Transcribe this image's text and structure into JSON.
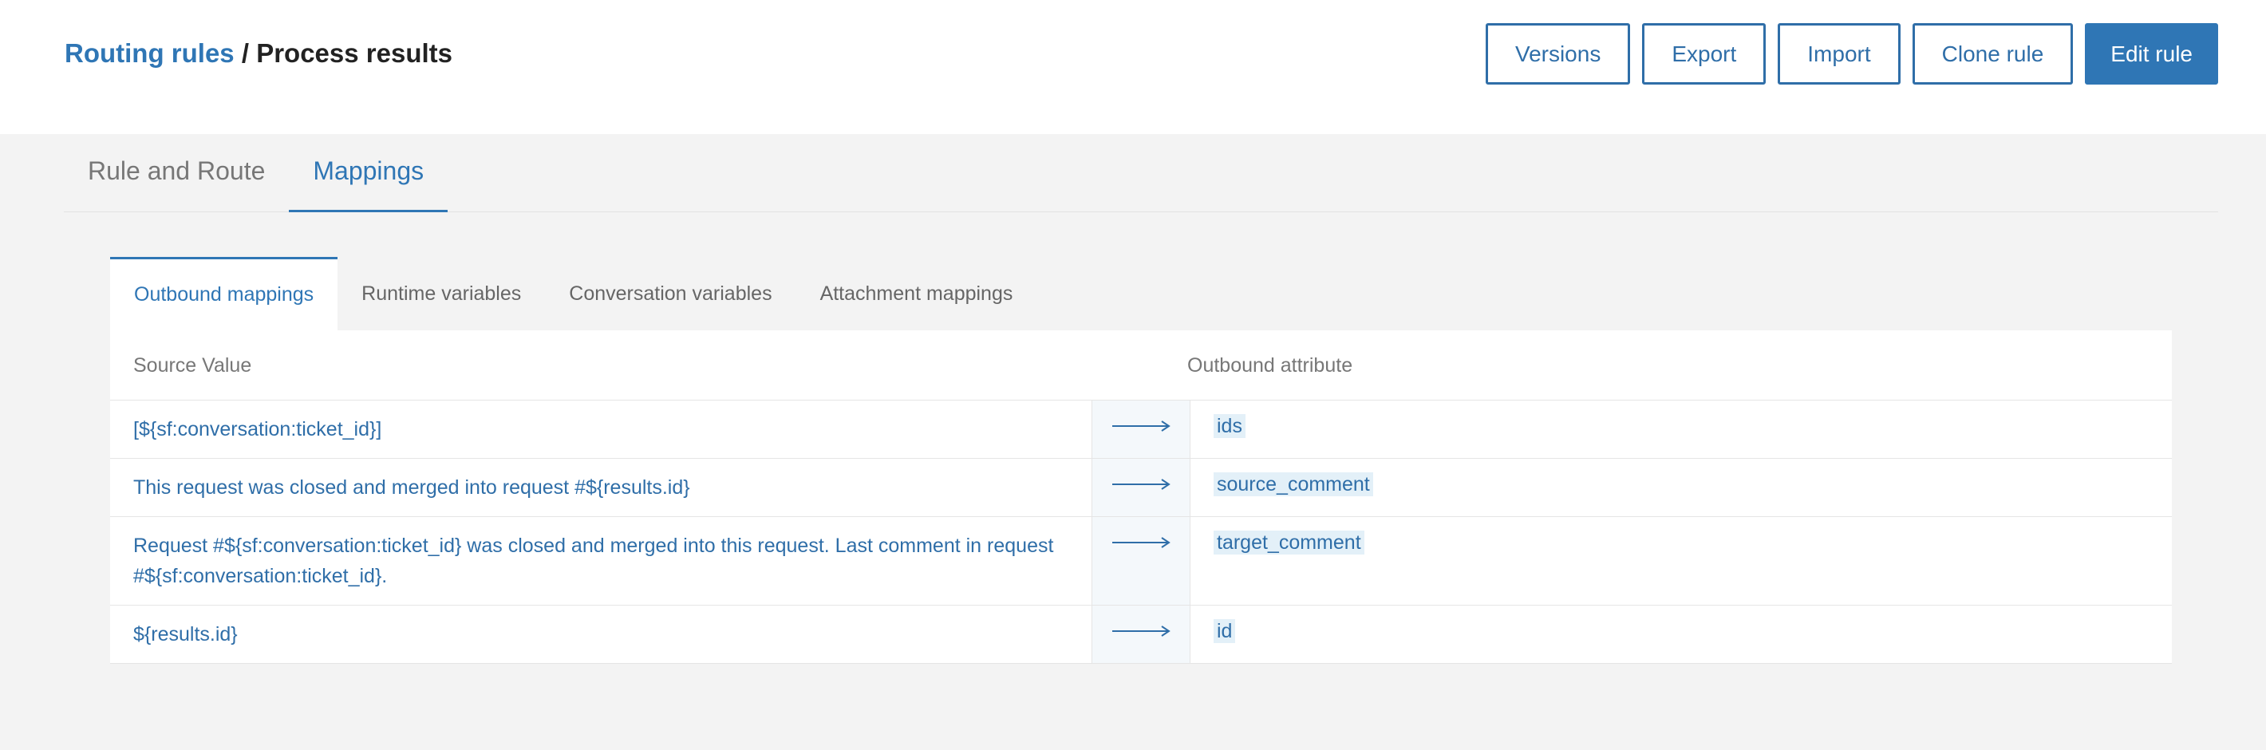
{
  "header": {
    "breadcrumb_link": "Routing rules",
    "breadcrumb_separator": " / ",
    "breadcrumb_current": "Process results",
    "buttons": {
      "versions": "Versions",
      "export": "Export",
      "import": "Import",
      "clone": "Clone rule",
      "edit": "Edit rule"
    }
  },
  "main_tabs": {
    "rule_and_route": "Rule and Route",
    "mappings": "Mappings",
    "active": "Mappings"
  },
  "sub_tabs": {
    "outbound": "Outbound mappings",
    "runtime": "Runtime variables",
    "conversation": "Conversation variables",
    "attachment": "Attachment mappings",
    "active": "Outbound mappings"
  },
  "table": {
    "headers": {
      "source": "Source Value",
      "target": "Outbound attribute"
    },
    "rows": [
      {
        "source": "[${sf:conversation:ticket_id}]",
        "target": "ids"
      },
      {
        "source": "This request was closed and merged into request #${results.id}",
        "target": "source_comment"
      },
      {
        "source": "Request #${sf:conversation:ticket_id} was closed and merged into this request. Last comment in request #${sf:conversation:ticket_id}.",
        "target": "target_comment"
      },
      {
        "source": "${results.id}",
        "target": "id"
      }
    ]
  },
  "icons": {
    "mapping_arrow": "arrow-right-icon"
  },
  "colors": {
    "accent": "#2f76b5",
    "tag_background": "#e3f0f8",
    "page_background": "#f3f3f3"
  }
}
